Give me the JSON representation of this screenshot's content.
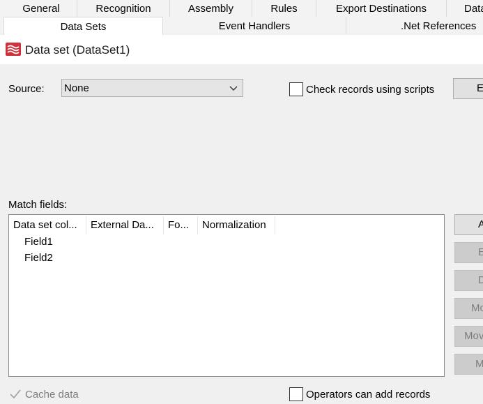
{
  "tabs": {
    "row1": [
      "General",
      "Recognition",
      "Assembly",
      "Rules",
      "Export Destinations",
      "Data"
    ],
    "row2": [
      "Data Sets",
      "Event Handlers",
      ".Net References"
    ],
    "active": "Data Sets"
  },
  "header": {
    "logo_icon": "dataset-icon",
    "title": "Data set (DataSet1)"
  },
  "source": {
    "label": "Source:",
    "value": "None",
    "arrow_icon": "chevron-down-icon"
  },
  "check_records": {
    "label": "Check records using scripts",
    "checked": false
  },
  "edit_button_label": "E",
  "match_fields": {
    "label": "Match  fields:",
    "columns": [
      "Data set col...",
      "External Da...",
      "Fo...",
      "Normalization"
    ],
    "rows": [
      "Field1",
      "Field2"
    ]
  },
  "side_buttons": [
    {
      "label": "A",
      "enabled": true
    },
    {
      "label": "E",
      "enabled": false
    },
    {
      "label": "D",
      "enabled": false
    },
    {
      "label": "Mo",
      "enabled": false
    },
    {
      "label": "Mov",
      "enabled": false
    },
    {
      "label": "M",
      "enabled": false
    }
  ],
  "cache_data": {
    "label": "Cache data",
    "checked": true,
    "enabled": false
  },
  "operators_add": {
    "label": "Operators can add records",
    "checked": false
  },
  "colors": {
    "background": "#f0f0f0",
    "white": "#ffffff",
    "logo_red": "#d0313a",
    "disabled_text": "#7e7e7e"
  }
}
